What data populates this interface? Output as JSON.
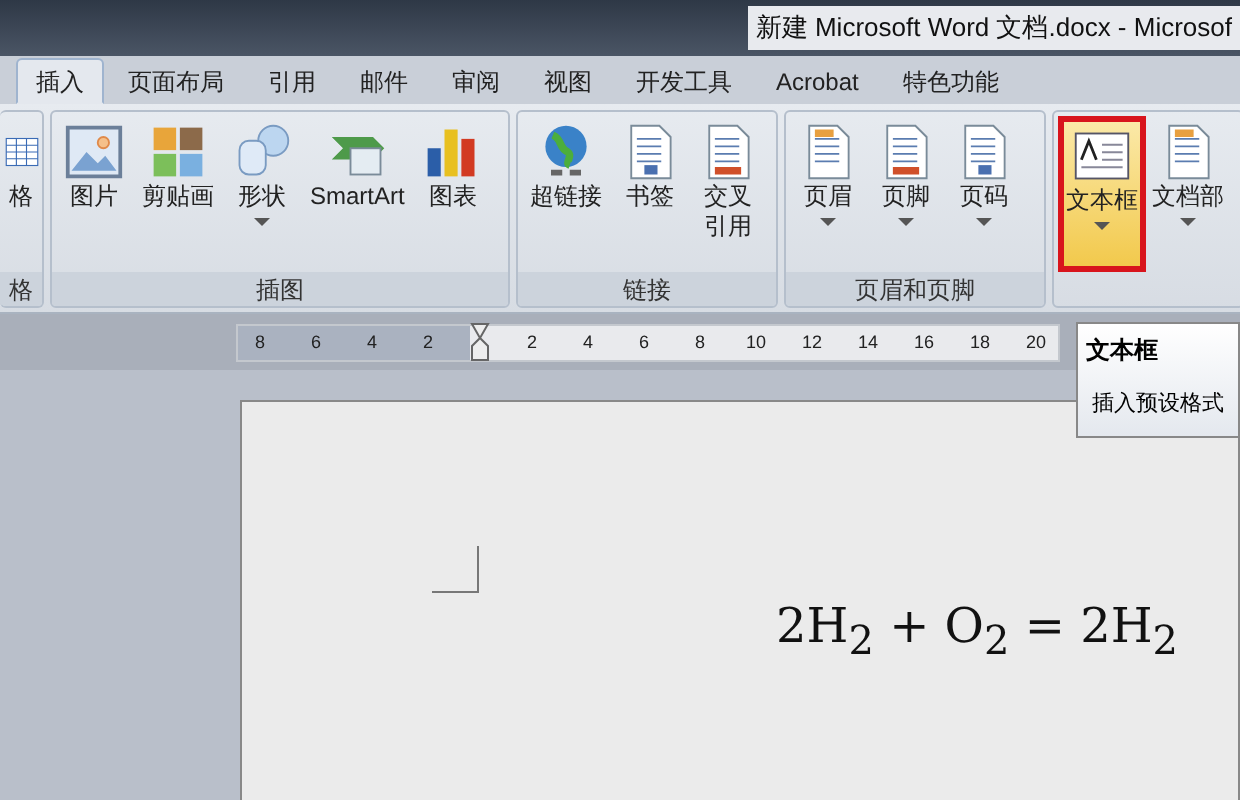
{
  "window": {
    "title": "新建 Microsoft Word 文档.docx - Microsof"
  },
  "tabs": [
    {
      "label": "插入",
      "selected": true
    },
    {
      "label": "页面布局",
      "selected": false
    },
    {
      "label": "引用",
      "selected": false
    },
    {
      "label": "邮件",
      "selected": false
    },
    {
      "label": "审阅",
      "selected": false
    },
    {
      "label": "视图",
      "selected": false
    },
    {
      "label": "开发工具",
      "selected": false
    },
    {
      "label": "Acrobat",
      "selected": false
    },
    {
      "label": "特色功能",
      "selected": false
    }
  ],
  "groups": [
    {
      "label": "格",
      "buttons": [
        {
          "kind": "table",
          "label_lines": [
            "格"
          ],
          "dropdown": false,
          "selected": false
        }
      ]
    },
    {
      "label": "插图",
      "buttons": [
        {
          "kind": "picture",
          "label_lines": [
            "图片"
          ],
          "dropdown": false,
          "selected": false
        },
        {
          "kind": "clipart",
          "label_lines": [
            "剪贴画"
          ],
          "dropdown": false,
          "selected": false
        },
        {
          "kind": "shapes",
          "label_lines": [
            "形状"
          ],
          "dropdown": true,
          "selected": false
        },
        {
          "kind": "smartart",
          "label_lines": [
            "SmartArt"
          ],
          "dropdown": false,
          "selected": false
        },
        {
          "kind": "chart",
          "label_lines": [
            "图表"
          ],
          "dropdown": false,
          "selected": false
        }
      ]
    },
    {
      "label": "链接",
      "buttons": [
        {
          "kind": "globe",
          "label_lines": [
            "超链接"
          ],
          "dropdown": false,
          "selected": false
        },
        {
          "kind": "bookmark",
          "label_lines": [
            "书签"
          ],
          "dropdown": false,
          "selected": false
        },
        {
          "kind": "crossref",
          "label_lines": [
            "交叉",
            "引用"
          ],
          "dropdown": false,
          "selected": false
        }
      ]
    },
    {
      "label": "页眉和页脚",
      "buttons": [
        {
          "kind": "header",
          "label_lines": [
            "页眉"
          ],
          "dropdown": true,
          "selected": false
        },
        {
          "kind": "footer",
          "label_lines": [
            "页脚"
          ],
          "dropdown": true,
          "selected": false
        },
        {
          "kind": "pagenum",
          "label_lines": [
            "页码"
          ],
          "dropdown": true,
          "selected": false
        }
      ]
    },
    {
      "buttons": [
        {
          "kind": "textbox",
          "label_lines": [
            "文本框"
          ],
          "dropdown": true,
          "selected": true
        },
        {
          "kind": "parts",
          "label_lines": [
            "文档部"
          ],
          "dropdown": true,
          "selected": false
        }
      ]
    }
  ],
  "ruler": {
    "left_ticks": [
      "8",
      "6",
      "4",
      "2"
    ],
    "right_ticks": [
      "2",
      "4",
      "6",
      "8",
      "10",
      "12",
      "14",
      "16",
      "18",
      "20"
    ]
  },
  "tooltip": {
    "title": "文本框",
    "text": "插入预设格式"
  },
  "document": {
    "equation": "2H$_{2}$ + O$_{2}$ = 2H$_{2}$"
  }
}
